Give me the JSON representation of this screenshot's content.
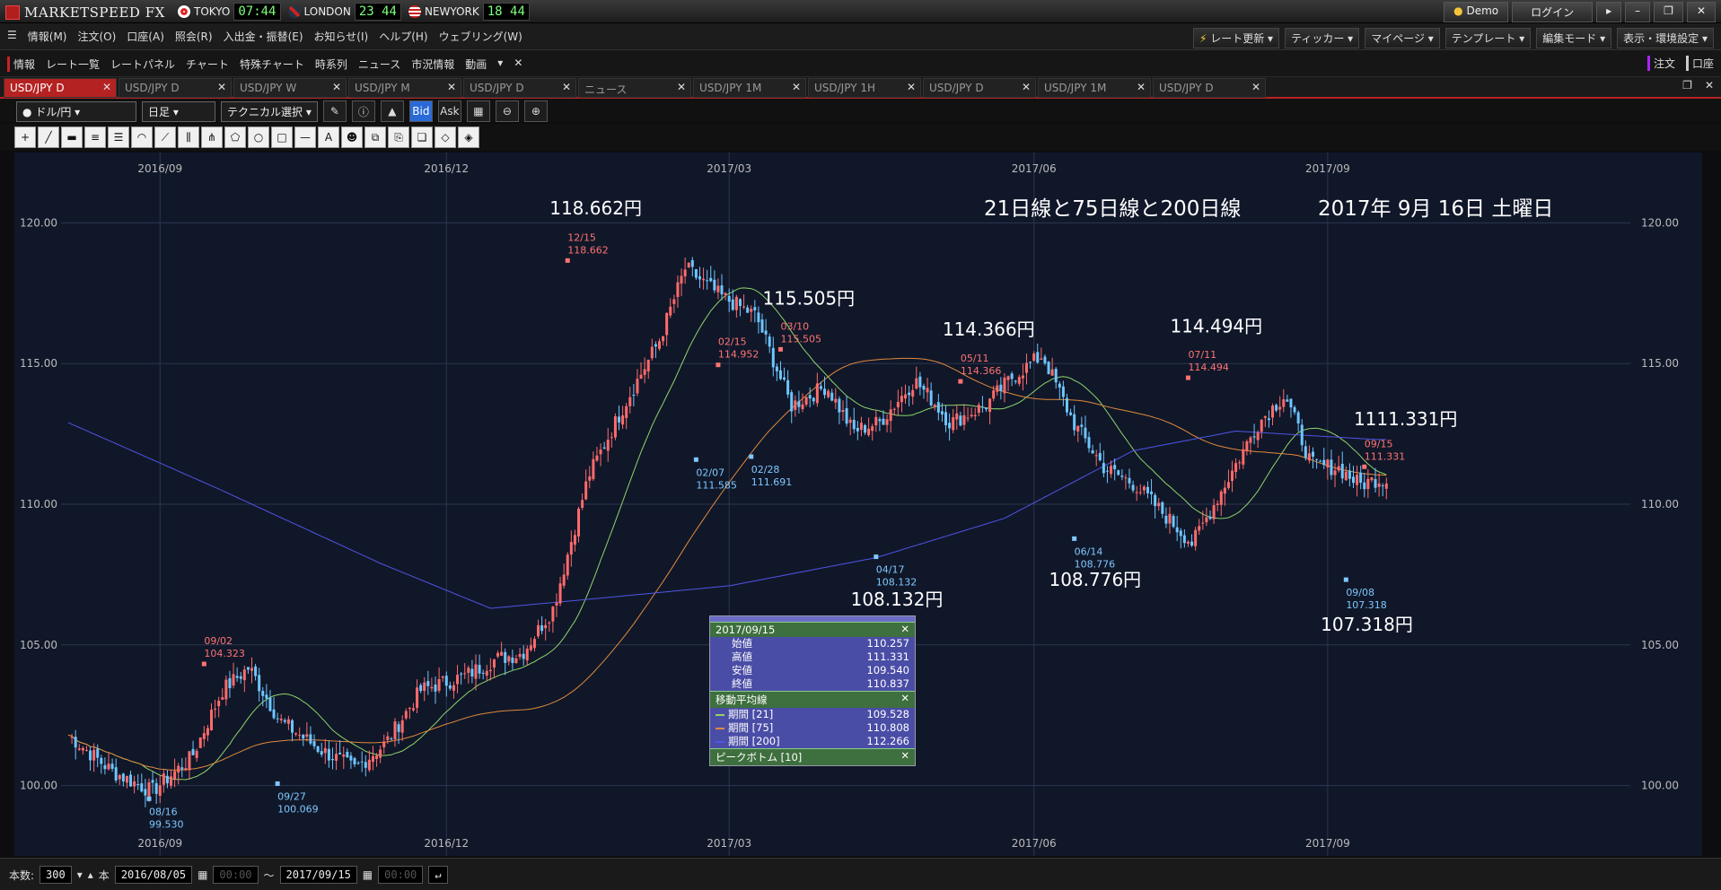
{
  "app": {
    "title": "MARKETSPEED FX"
  },
  "clocks": [
    {
      "city": "TOKYO",
      "time": "07:44",
      "color": "#d22"
    },
    {
      "city": "LONDON",
      "time": "23 44",
      "color": "#335"
    },
    {
      "city": "NEWYORK",
      "time": "18 44",
      "color": "#35a"
    }
  ],
  "window": {
    "demo": "Demo",
    "login": "ログイン"
  },
  "menus": [
    "情報(M)",
    "注文(O)",
    "口座(A)",
    "照会(R)",
    "入出金・振替(E)",
    "お知らせ(I)",
    "ヘルプ(H)",
    "ウェブリング(W)"
  ],
  "right_tools": [
    "レート更新",
    "ティッカー",
    "マイページ",
    "テンプレート",
    "編集モード",
    "表示・環境設定"
  ],
  "funcbar": {
    "items": [
      "情報",
      "レート一覧",
      "レートパネル",
      "チャート",
      "特殊チャート",
      "時系列",
      "ニュース",
      "市況情報",
      "動画"
    ],
    "order": "注文",
    "account": "口座"
  },
  "tabs": [
    "USD/JPY D",
    "USD/JPY D",
    "USD/JPY W",
    "USD/JPY M",
    "USD/JPY D",
    "ニュース",
    "USD/JPY 1M",
    "USD/JPY 1H",
    "USD/JPY D",
    "USD/JPY 1M",
    "USD/JPY D"
  ],
  "chart_controls": {
    "pair": "ドル/円",
    "period": "日足",
    "technical": "テクニカル選択",
    "bid": "Bid",
    "ask": "Ask"
  },
  "status": {
    "count_label": "本数:",
    "count": "300",
    "unit": "本",
    "from": "2016/08/05",
    "from_time": "00:00",
    "tilde": "〜",
    "to": "2017/09/15",
    "to_time": "00:00"
  },
  "annotation": {
    "title": "21日線と75日線と200日線",
    "date": "2017年 9月 16日 土曜日"
  },
  "colors": {
    "up": "#ff6b6b",
    "down": "#6ec6ff",
    "ma21": "#8fd46a",
    "ma75": "#e08a3c",
    "ma200": "#4f55e6",
    "bg": "#101729"
  },
  "chart_data": {
    "type": "candlestick",
    "symbol": "USD/JPY",
    "timeframe": "D",
    "ylim": [
      97.5,
      122.5
    ],
    "yticks": [
      "120.00",
      "115.00",
      "110.00",
      "105.00",
      "100.00"
    ],
    "ytick_values": [
      120,
      115,
      110,
      105,
      100
    ],
    "xticks": [
      "2016/09",
      "2016/12",
      "2017/03",
      "2017/06",
      "2017/09"
    ],
    "xtick_index": [
      25,
      103,
      180,
      263,
      343
    ],
    "n": 300,
    "anchors": [
      [
        0,
        101.8
      ],
      [
        10,
        100.5
      ],
      [
        19,
        99.8
      ],
      [
        28,
        101.0
      ],
      [
        35,
        103.4
      ],
      [
        41,
        104.2
      ],
      [
        48,
        102.3
      ],
      [
        57,
        101.3
      ],
      [
        65,
        100.6
      ],
      [
        72,
        101.5
      ],
      [
        80,
        103.4
      ],
      [
        90,
        103.9
      ],
      [
        97,
        104.5
      ],
      [
        103,
        104.7
      ],
      [
        110,
        106.3
      ],
      [
        118,
        111.0
      ],
      [
        127,
        113.8
      ],
      [
        134,
        115.8
      ],
      [
        140,
        118.4
      ],
      [
        148,
        117.4
      ],
      [
        156,
        116.7
      ],
      [
        164,
        113.5
      ],
      [
        172,
        114.2
      ],
      [
        178,
        112.6
      ],
      [
        184,
        112.9
      ],
      [
        192,
        114.4
      ],
      [
        196,
        113.7
      ],
      [
        200,
        112.9
      ],
      [
        208,
        113.5
      ],
      [
        214,
        114.5
      ],
      [
        221,
        115.3
      ],
      [
        228,
        112.9
      ],
      [
        235,
        111.3
      ],
      [
        242,
        110.7
      ],
      [
        250,
        109.4
      ],
      [
        255,
        108.6
      ],
      [
        262,
        110.6
      ],
      [
        270,
        112.9
      ],
      [
        276,
        113.9
      ],
      [
        282,
        111.4
      ],
      [
        288,
        111.3
      ],
      [
        293,
        110.7
      ],
      [
        297,
        110.9
      ],
      [
        299,
        110.84
      ]
    ],
    "ma200_anchors": [
      [
        0,
        112.9
      ],
      [
        40,
        110.6
      ],
      [
        85,
        107.9
      ],
      [
        115,
        106.3
      ],
      [
        140,
        106.6
      ],
      [
        180,
        107.1
      ],
      [
        220,
        108.1
      ],
      [
        255,
        109.5
      ],
      [
        290,
        111.9
      ],
      [
        318,
        112.6
      ],
      [
        356,
        112.3
      ]
    ],
    "peaks": [
      {
        "date": "08/16",
        "price": "99.530",
        "type": "low",
        "idx": 22,
        "val": 99.53
      },
      {
        "date": "09/02",
        "price": "104.323",
        "type": "high",
        "idx": 37,
        "val": 104.323
      },
      {
        "date": "09/27",
        "price": "100.069",
        "type": "low",
        "idx": 57,
        "val": 100.069
      },
      {
        "date": "12/15",
        "price": "118.662",
        "type": "high",
        "idx": 136,
        "val": 118.662
      },
      {
        "date": "02/07",
        "price": "111.585",
        "type": "low",
        "idx": 171,
        "val": 111.585
      },
      {
        "date": "02/15",
        "price": "114.952",
        "type": "high",
        "idx": 177,
        "val": 114.952
      },
      {
        "date": "02/28",
        "price": "111.691",
        "type": "low",
        "idx": 186,
        "val": 111.691
      },
      {
        "date": "03/10",
        "price": "115.505",
        "type": "high",
        "idx": 194,
        "val": 115.505
      },
      {
        "date": "04/17",
        "price": "108.132",
        "type": "low",
        "idx": 220,
        "val": 108.132
      },
      {
        "date": "05/11",
        "price": "114.366",
        "type": "high",
        "idx": 243,
        "val": 114.366
      },
      {
        "date": "06/14",
        "price": "108.776",
        "type": "low",
        "idx": 274,
        "val": 108.776
      },
      {
        "date": "07/11",
        "price": "114.494",
        "type": "high",
        "idx": 305,
        "val": 114.494
      },
      {
        "date": "09/08",
        "price": "107.318",
        "type": "low",
        "idx": 348,
        "val": 107.318
      },
      {
        "date": "09/15",
        "price": "111.331",
        "type": "high",
        "idx": 353,
        "val": 111.331
      }
    ],
    "big_labels": [
      {
        "text": "118.662円",
        "idx": 136,
        "val": 120.3
      },
      {
        "text": "115.505円",
        "idx": 194,
        "val": 117.1
      },
      {
        "text": "114.366円",
        "idx": 243,
        "val": 116.0
      },
      {
        "text": "114.494円",
        "idx": 305,
        "val": 116.1
      },
      {
        "text": "108.132円",
        "idx": 218,
        "val": 106.4
      },
      {
        "text": "108.776円",
        "idx": 272,
        "val": 107.1
      },
      {
        "text": "107.318円",
        "idx": 346,
        "val": 105.5
      },
      {
        "text": "1111.331円",
        "idx": 355,
        "val": 112.8
      }
    ]
  },
  "info_panel": {
    "date": "2017/09/15",
    "ohlc": [
      {
        "label": "始値",
        "value": "110.257"
      },
      {
        "label": "高値",
        "value": "111.331"
      },
      {
        "label": "安値",
        "value": "109.540"
      },
      {
        "label": "終値",
        "value": "110.837"
      }
    ],
    "ma_title": "移動平均線",
    "ma": [
      {
        "label": "期間 [21]",
        "value": "109.528",
        "color": "#8fd46a"
      },
      {
        "label": "期間 [75]",
        "value": "110.808",
        "color": "#e08a3c"
      },
      {
        "label": "期間 [200]",
        "value": "112.266",
        "color": "#4f55e6"
      }
    ],
    "peak_title": "ピークボトム [10]"
  }
}
